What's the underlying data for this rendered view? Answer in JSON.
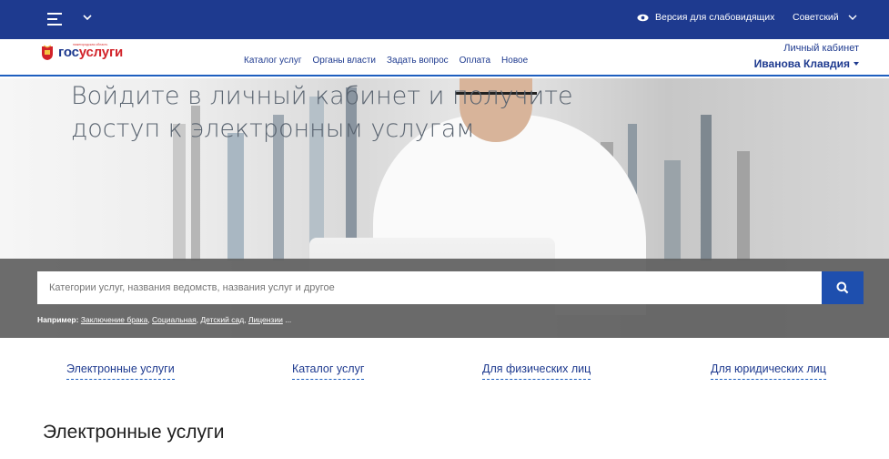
{
  "topbar": {
    "vision_label": "Версия для слабовидящих",
    "region_label": "Советский"
  },
  "header": {
    "logo_sub": "нижегородская область",
    "logo_gos": "гос",
    "logo_uslugi": "услуги",
    "nav": [
      "Каталог услуг",
      "Органы власти",
      "Задать вопрос",
      "Оплата",
      "Новое"
    ],
    "cabinet_label": "Личный кабинет",
    "user_name": "Иванова Клавдия"
  },
  "hero": {
    "title": "Войдите в личный кабинет и получите доступ к электронным услугам"
  },
  "search": {
    "placeholder": "Категории услуг, названия ведомств, названия услуг и другое",
    "examples_label": "Например:",
    "examples": [
      "Заключение брака",
      "Социальная",
      "Детский сад",
      "Лицензии"
    ],
    "examples_more": "..."
  },
  "tabs": [
    "Электронные услуги",
    "Каталог услуг",
    "Для физических лиц",
    "Для юридических лиц"
  ],
  "section_title": "Электронные услуги",
  "colors": {
    "topbar": "#1e3a8f",
    "accent": "#1e4fae",
    "brand_red": "#d2232a"
  }
}
